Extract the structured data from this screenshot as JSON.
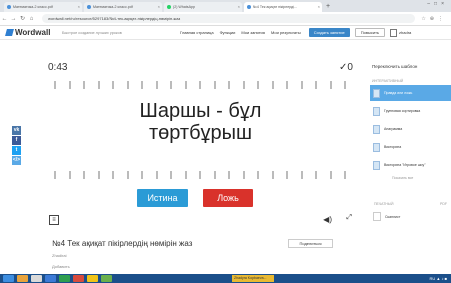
{
  "browser": {
    "tabs": [
      {
        "label": "Математика-2 класс.pdf"
      },
      {
        "label": "Математика-2 класс.pdf"
      },
      {
        "label": "(2) WhatsApp"
      },
      {
        "label": "№4 Тек ақиқат пікірлерді..."
      }
    ],
    "new_tab": "+",
    "url": "wordwall.net/ru/resource/5297183/№4-тек-ақиқат-пікірлердің-нөмірін-жаз"
  },
  "header": {
    "logo": "Wordwall",
    "slogan": "Быстрое создание лучших уроков",
    "menu": [
      "Главная страница",
      "Функции",
      "Мои занятия",
      "Мои результаты"
    ],
    "create_button": "Создать занятие",
    "upgrade_button": "Повысить",
    "user": "zhadra"
  },
  "social": {
    "items": [
      {
        "label": "vk",
        "color": "#4a76a8"
      },
      {
        "label": "f",
        "color": "#3b5998"
      },
      {
        "label": "t",
        "color": "#1da1f2"
      },
      {
        "label": "</>",
        "color": "#5aa9e6"
      }
    ]
  },
  "game": {
    "timer": "0:43",
    "score": "✓0",
    "question_line1": "Шаршы - бұл",
    "question_line2": "төртбұрыш",
    "true_button": "Истина",
    "false_button": "Ложь"
  },
  "activity": {
    "title": "№4 Тек ақиқат пікірлердің нөмірін жаз",
    "share_button": "Поделиться",
    "meta_author": "Zhadirai",
    "meta_edit": "Добавить"
  },
  "panel": {
    "title": "Переключить шаблон",
    "interactive_label": "ИНТЕРАКТИВНЫЙ",
    "templates": [
      {
        "label": "Правда или ложь",
        "active": true
      },
      {
        "label": "Групповая сортировка",
        "active": false
      },
      {
        "label": "Анаграмма",
        "active": false
      },
      {
        "label": "Викторина",
        "active": false
      },
      {
        "label": "Викторина \"Игровое шоу\"",
        "active": false
      }
    ],
    "show_all": "Показать все",
    "print_label": "ПЕЧАТНЫЙ",
    "print_pdf": "PDF",
    "print_item": "Сканлист"
  },
  "taskbar": {
    "notification": "Zhadyra Kopbaeva...",
    "clock": "RU  ▲  ♪  ■"
  }
}
